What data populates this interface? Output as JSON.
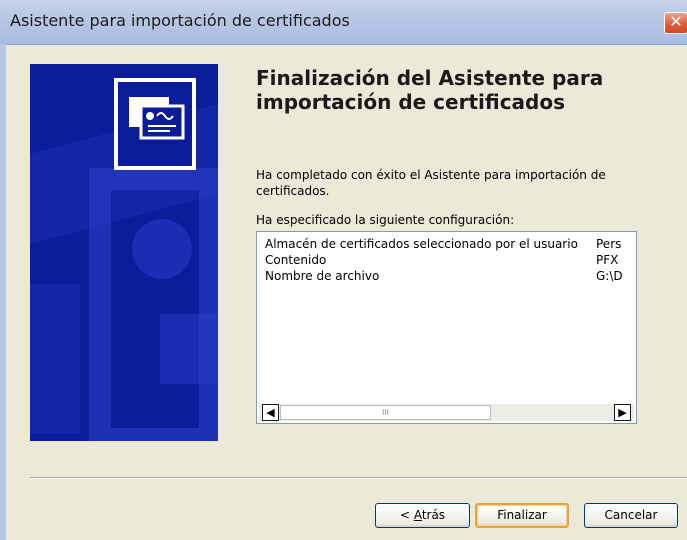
{
  "window": {
    "title": "Asistente para importación de certificados",
    "close_symbol": "✕"
  },
  "wizard": {
    "heading": "Finalización del Asistente para importación de certificados",
    "description": "Ha completado con éxito el Asistente para importación de certificados.",
    "config_label": "Ha especificado la siguiente configuración:",
    "settings": [
      {
        "name": "Almacén de certificados seleccionado por el usuario",
        "value": "Pers"
      },
      {
        "name": "Contenido",
        "value": "PFX"
      },
      {
        "name": "Nombre de archivo",
        "value": "G:\\D"
      }
    ],
    "scroll_thumb_grip": "III"
  },
  "buttons": {
    "back_prefix": "< ",
    "back_mnemonic": "A",
    "back_rest": "trás",
    "finish": "Finalizar",
    "cancel": "Cancelar"
  },
  "icons": {
    "scroll_left": "◀",
    "scroll_right": "▶",
    "certificate": "certificate-icon"
  },
  "colors": {
    "watermark_bg": "#0b1c9a",
    "dialog_bg": "#ece9d8",
    "default_button_ring": "#e8a43a"
  }
}
